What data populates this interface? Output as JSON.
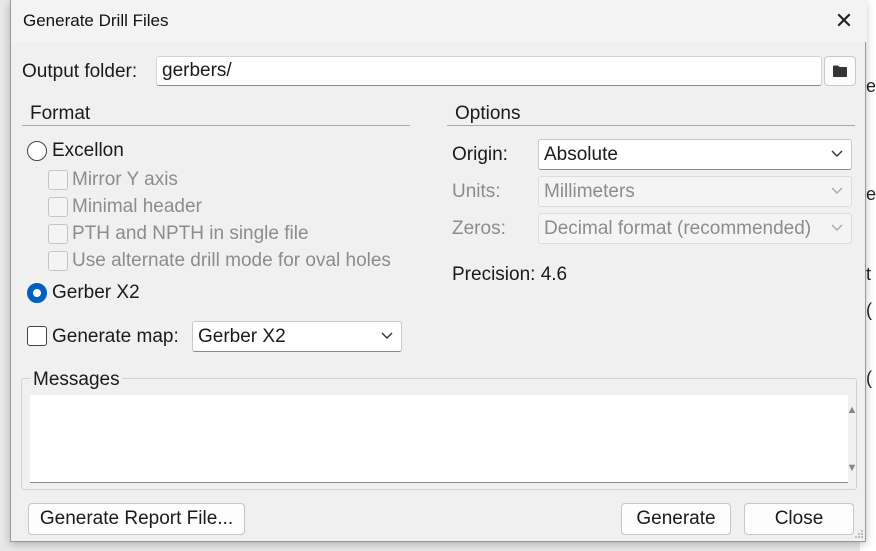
{
  "title": "Generate Drill Files",
  "output_folder": {
    "label": "Output folder:",
    "value": "gerbers/"
  },
  "format": {
    "title": "Format",
    "excellon_label": "Excellon",
    "excellon_options": [
      "Mirror Y axis",
      "Minimal header",
      "PTH and NPTH in single file",
      "Use alternate drill mode for oval holes"
    ],
    "gerber_label": "Gerber X2",
    "selected": "Gerber X2",
    "generate_map_label": "Generate map:",
    "map_format": "Gerber X2"
  },
  "options": {
    "title": "Options",
    "origin_label": "Origin:",
    "origin_value": "Absolute",
    "units_label": "Units:",
    "units_value": "Millimeters",
    "zeros_label": "Zeros:",
    "zeros_value": "Decimal format (recommended)",
    "precision_text": "Precision: 4.6"
  },
  "messages": {
    "title": "Messages"
  },
  "buttons": {
    "report": "Generate Report File...",
    "generate": "Generate",
    "close": "Close"
  },
  "colors": {
    "accent": "#0060c0",
    "dialog_bg": "#f0f0f0",
    "disabled_text": "#8c8c8c"
  },
  "background_fragments": [
    "e",
    "e",
    "t",
    "(",
    "("
  ]
}
